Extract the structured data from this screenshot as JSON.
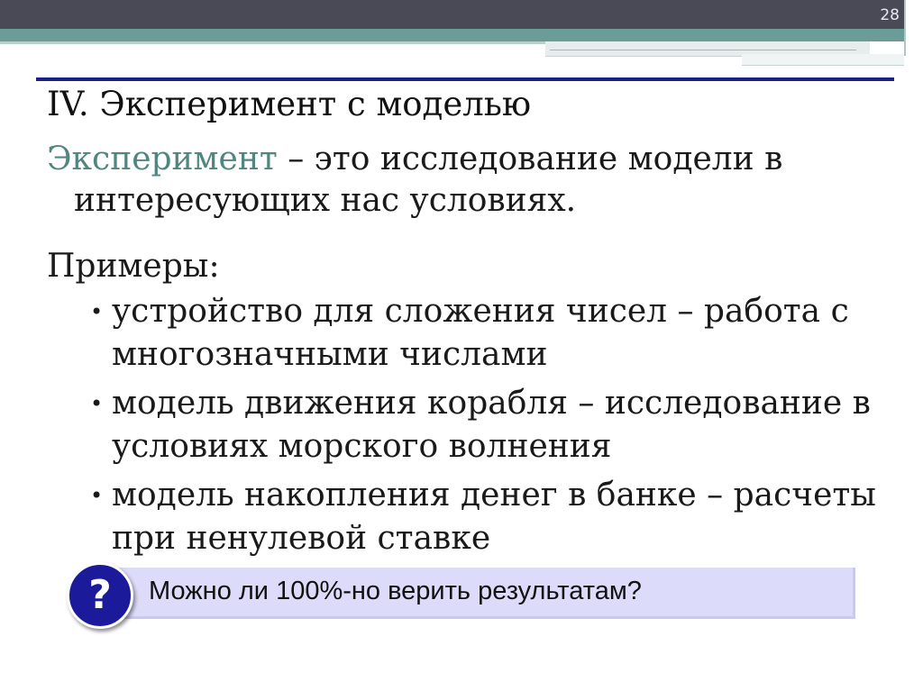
{
  "slide": {
    "page_number": "28",
    "title": "IV. Эксперимент с моделью",
    "definition": {
      "term": "Эксперимент",
      "rest_line1": " – это исследование модели в",
      "rest_line2": "интересующих нас условиях."
    },
    "examples_label": "Примеры:",
    "bullet_glyph": "•",
    "examples": [
      {
        "line1": "устройство для сложения чисел – работа с",
        "line2": "многозначными числами"
      },
      {
        "line1": "модель движения корабля – исследование в",
        "line2": "условиях морского волнения"
      },
      {
        "line1": "модель накопления денег в банке – расчеты",
        "line2": "при ненулевой ставке"
      }
    ],
    "question": {
      "icon_glyph": "?",
      "text": "Можно ли 100%-но верить результатам?"
    }
  },
  "colors": {
    "title_rule": "#1b1f8a",
    "term": "#4f8680",
    "question_box": "#dcdcfa",
    "question_circle": "#1a1a9a",
    "top_bar": "#4a4a56",
    "top_teal": "#6b9c98"
  }
}
